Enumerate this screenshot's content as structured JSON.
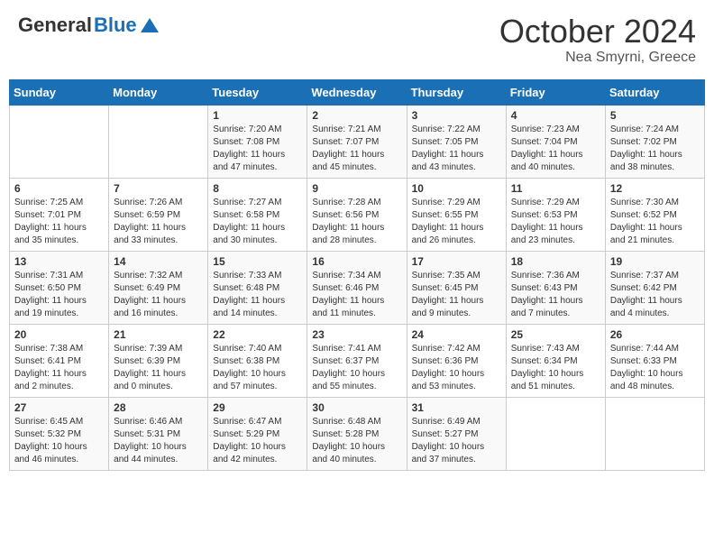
{
  "header": {
    "logo_general": "General",
    "logo_blue": "Blue",
    "month": "October 2024",
    "location": "Nea Smyrni, Greece"
  },
  "days_of_week": [
    "Sunday",
    "Monday",
    "Tuesday",
    "Wednesday",
    "Thursday",
    "Friday",
    "Saturday"
  ],
  "weeks": [
    [
      {
        "day": null,
        "sunrise": null,
        "sunset": null,
        "daylight": null
      },
      {
        "day": null,
        "sunrise": null,
        "sunset": null,
        "daylight": null
      },
      {
        "day": "1",
        "sunrise": "7:20 AM",
        "sunset": "7:08 PM",
        "daylight": "11 hours and 47 minutes."
      },
      {
        "day": "2",
        "sunrise": "7:21 AM",
        "sunset": "7:07 PM",
        "daylight": "11 hours and 45 minutes."
      },
      {
        "day": "3",
        "sunrise": "7:22 AM",
        "sunset": "7:05 PM",
        "daylight": "11 hours and 43 minutes."
      },
      {
        "day": "4",
        "sunrise": "7:23 AM",
        "sunset": "7:04 PM",
        "daylight": "11 hours and 40 minutes."
      },
      {
        "day": "5",
        "sunrise": "7:24 AM",
        "sunset": "7:02 PM",
        "daylight": "11 hours and 38 minutes."
      }
    ],
    [
      {
        "day": "6",
        "sunrise": "7:25 AM",
        "sunset": "7:01 PM",
        "daylight": "11 hours and 35 minutes."
      },
      {
        "day": "7",
        "sunrise": "7:26 AM",
        "sunset": "6:59 PM",
        "daylight": "11 hours and 33 minutes."
      },
      {
        "day": "8",
        "sunrise": "7:27 AM",
        "sunset": "6:58 PM",
        "daylight": "11 hours and 30 minutes."
      },
      {
        "day": "9",
        "sunrise": "7:28 AM",
        "sunset": "6:56 PM",
        "daylight": "11 hours and 28 minutes."
      },
      {
        "day": "10",
        "sunrise": "7:29 AM",
        "sunset": "6:55 PM",
        "daylight": "11 hours and 26 minutes."
      },
      {
        "day": "11",
        "sunrise": "7:29 AM",
        "sunset": "6:53 PM",
        "daylight": "11 hours and 23 minutes."
      },
      {
        "day": "12",
        "sunrise": "7:30 AM",
        "sunset": "6:52 PM",
        "daylight": "11 hours and 21 minutes."
      }
    ],
    [
      {
        "day": "13",
        "sunrise": "7:31 AM",
        "sunset": "6:50 PM",
        "daylight": "11 hours and 19 minutes."
      },
      {
        "day": "14",
        "sunrise": "7:32 AM",
        "sunset": "6:49 PM",
        "daylight": "11 hours and 16 minutes."
      },
      {
        "day": "15",
        "sunrise": "7:33 AM",
        "sunset": "6:48 PM",
        "daylight": "11 hours and 14 minutes."
      },
      {
        "day": "16",
        "sunrise": "7:34 AM",
        "sunset": "6:46 PM",
        "daylight": "11 hours and 11 minutes."
      },
      {
        "day": "17",
        "sunrise": "7:35 AM",
        "sunset": "6:45 PM",
        "daylight": "11 hours and 9 minutes."
      },
      {
        "day": "18",
        "sunrise": "7:36 AM",
        "sunset": "6:43 PM",
        "daylight": "11 hours and 7 minutes."
      },
      {
        "day": "19",
        "sunrise": "7:37 AM",
        "sunset": "6:42 PM",
        "daylight": "11 hours and 4 minutes."
      }
    ],
    [
      {
        "day": "20",
        "sunrise": "7:38 AM",
        "sunset": "6:41 PM",
        "daylight": "11 hours and 2 minutes."
      },
      {
        "day": "21",
        "sunrise": "7:39 AM",
        "sunset": "6:39 PM",
        "daylight": "11 hours and 0 minutes."
      },
      {
        "day": "22",
        "sunrise": "7:40 AM",
        "sunset": "6:38 PM",
        "daylight": "10 hours and 57 minutes."
      },
      {
        "day": "23",
        "sunrise": "7:41 AM",
        "sunset": "6:37 PM",
        "daylight": "10 hours and 55 minutes."
      },
      {
        "day": "24",
        "sunrise": "7:42 AM",
        "sunset": "6:36 PM",
        "daylight": "10 hours and 53 minutes."
      },
      {
        "day": "25",
        "sunrise": "7:43 AM",
        "sunset": "6:34 PM",
        "daylight": "10 hours and 51 minutes."
      },
      {
        "day": "26",
        "sunrise": "7:44 AM",
        "sunset": "6:33 PM",
        "daylight": "10 hours and 48 minutes."
      }
    ],
    [
      {
        "day": "27",
        "sunrise": "6:45 AM",
        "sunset": "5:32 PM",
        "daylight": "10 hours and 46 minutes."
      },
      {
        "day": "28",
        "sunrise": "6:46 AM",
        "sunset": "5:31 PM",
        "daylight": "10 hours and 44 minutes."
      },
      {
        "day": "29",
        "sunrise": "6:47 AM",
        "sunset": "5:29 PM",
        "daylight": "10 hours and 42 minutes."
      },
      {
        "day": "30",
        "sunrise": "6:48 AM",
        "sunset": "5:28 PM",
        "daylight": "10 hours and 40 minutes."
      },
      {
        "day": "31",
        "sunrise": "6:49 AM",
        "sunset": "5:27 PM",
        "daylight": "10 hours and 37 minutes."
      },
      {
        "day": null,
        "sunrise": null,
        "sunset": null,
        "daylight": null
      },
      {
        "day": null,
        "sunrise": null,
        "sunset": null,
        "daylight": null
      }
    ]
  ],
  "labels": {
    "sunrise_prefix": "Sunrise: ",
    "sunset_prefix": "Sunset: ",
    "daylight_prefix": "Daylight: "
  }
}
